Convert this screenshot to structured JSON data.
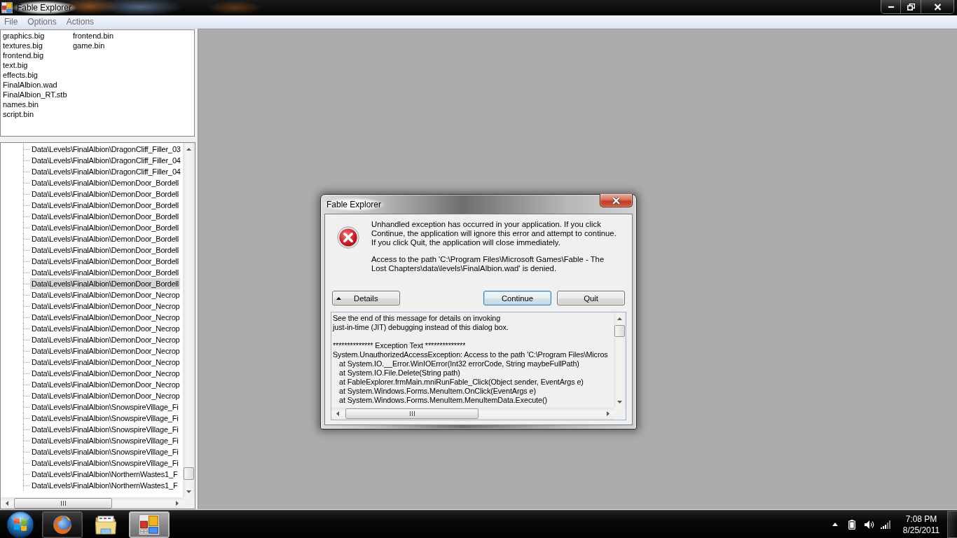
{
  "window": {
    "title": "Fable Explorer",
    "menu": [
      "File",
      "Options",
      "Actions"
    ]
  },
  "file_list": {
    "items": [
      "graphics.big",
      "textures.big",
      "frontend.big",
      "text.big",
      "effects.big",
      "FinalAlbion.wad",
      "FinalAlbion_RT.stb",
      "names.bin",
      "script.bin",
      "frontend.bin",
      "game.bin"
    ]
  },
  "tree": {
    "items": [
      {
        "label": "Data\\Levels\\FinalAlbion\\DragonCliff_Filler_03",
        "selected": false
      },
      {
        "label": "Data\\Levels\\FinalAlbion\\DragonCliff_Filler_04",
        "selected": false
      },
      {
        "label": "Data\\Levels\\FinalAlbion\\DragonCliff_Filler_04",
        "selected": false
      },
      {
        "label": "Data\\Levels\\FinalAlbion\\DemonDoor_Bordell",
        "selected": false
      },
      {
        "label": "Data\\Levels\\FinalAlbion\\DemonDoor_Bordell",
        "selected": false
      },
      {
        "label": "Data\\Levels\\FinalAlbion\\DemonDoor_Bordell",
        "selected": false
      },
      {
        "label": "Data\\Levels\\FinalAlbion\\DemonDoor_Bordell",
        "selected": false
      },
      {
        "label": "Data\\Levels\\FinalAlbion\\DemonDoor_Bordell",
        "selected": false
      },
      {
        "label": "Data\\Levels\\FinalAlbion\\DemonDoor_Bordell",
        "selected": false
      },
      {
        "label": "Data\\Levels\\FinalAlbion\\DemonDoor_Bordell",
        "selected": false
      },
      {
        "label": "Data\\Levels\\FinalAlbion\\DemonDoor_Bordell",
        "selected": false
      },
      {
        "label": "Data\\Levels\\FinalAlbion\\DemonDoor_Bordell",
        "selected": false
      },
      {
        "label": "Data\\Levels\\FinalAlbion\\DemonDoor_Bordell",
        "selected": true
      },
      {
        "label": "Data\\Levels\\FinalAlbion\\DemonDoor_Necrop",
        "selected": false
      },
      {
        "label": "Data\\Levels\\FinalAlbion\\DemonDoor_Necrop",
        "selected": false
      },
      {
        "label": "Data\\Levels\\FinalAlbion\\DemonDoor_Necrop",
        "selected": false
      },
      {
        "label": "Data\\Levels\\FinalAlbion\\DemonDoor_Necrop",
        "selected": false
      },
      {
        "label": "Data\\Levels\\FinalAlbion\\DemonDoor_Necrop",
        "selected": false
      },
      {
        "label": "Data\\Levels\\FinalAlbion\\DemonDoor_Necrop",
        "selected": false
      },
      {
        "label": "Data\\Levels\\FinalAlbion\\DemonDoor_Necrop",
        "selected": false
      },
      {
        "label": "Data\\Levels\\FinalAlbion\\DemonDoor_Necrop",
        "selected": false
      },
      {
        "label": "Data\\Levels\\FinalAlbion\\DemonDoor_Necrop",
        "selected": false
      },
      {
        "label": "Data\\Levels\\FinalAlbion\\DemonDoor_Necrop",
        "selected": false
      },
      {
        "label": "Data\\Levels\\FinalAlbion\\SnowspireVillage_Fi",
        "selected": false
      },
      {
        "label": "Data\\Levels\\FinalAlbion\\SnowspireVillage_Fi",
        "selected": false
      },
      {
        "label": "Data\\Levels\\FinalAlbion\\SnowspireVillage_Fi",
        "selected": false
      },
      {
        "label": "Data\\Levels\\FinalAlbion\\SnowspireVillage_Fi",
        "selected": false
      },
      {
        "label": "Data\\Levels\\FinalAlbion\\SnowspireVillage_Fi",
        "selected": false
      },
      {
        "label": "Data\\Levels\\FinalAlbion\\SnowspireVillage_Fi",
        "selected": false
      },
      {
        "label": "Data\\Levels\\FinalAlbion\\NorthernWastes1_F",
        "selected": false
      },
      {
        "label": "Data\\Levels\\FinalAlbion\\NorthernWastes1_F",
        "selected": false
      }
    ]
  },
  "dialog": {
    "title": "Fable Explorer",
    "message": "Unhandled exception has occurred in your application. If you click Continue, the application will ignore this error and attempt to continue. If you click Quit, the application will close immediately.",
    "detail": "Access to the path 'C:\\Program Files\\Microsoft Games\\Fable - The Lost Chapters\\data\\levels\\FinalAlbion.wad' is denied.",
    "buttons": [
      {
        "label": "Details",
        "kind": "expander",
        "focused": false
      },
      {
        "label": "Continue",
        "kind": "push",
        "focused": true
      },
      {
        "label": "Quit",
        "kind": "push",
        "focused": false
      }
    ],
    "details": {
      "intro": [
        "See the end of this message for details on invoking",
        "just-in-time (JIT) debugging instead of this dialog box."
      ],
      "heading": "************** Exception Text **************",
      "exception": "System.UnauthorizedAccessException: Access to the path 'C:\\Program Files\\Micros",
      "stack": [
        "at System.IO.__Error.WinIOError(Int32 errorCode, String maybeFullPath)",
        "at System.IO.File.Delete(String path)",
        "at FableExplorer.frmMain.mniRunFable_Click(Object sender, EventArgs e)",
        "at System.Windows.Forms.MenuItem.OnClick(EventArgs e)",
        "at System.Windows.Forms.MenuItem.MenuItemData.Execute()"
      ]
    }
  },
  "taskbar": {
    "items": [
      {
        "kind": "browser",
        "running": true,
        "selected": false
      },
      {
        "kind": "folder",
        "running": false,
        "selected": false
      },
      {
        "kind": "app",
        "running": true,
        "selected": true
      }
    ],
    "clock": {
      "time": "7:08 PM",
      "date": "8/25/2011"
    }
  }
}
